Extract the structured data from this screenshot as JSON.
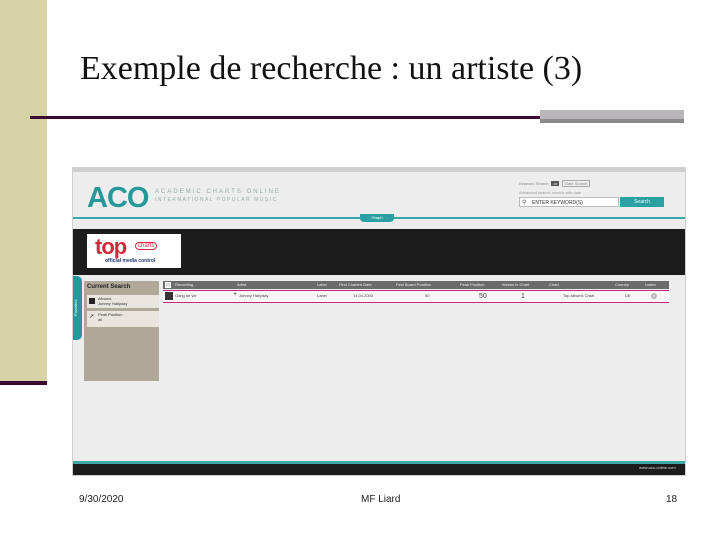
{
  "slide": {
    "title": "Exemple de recherche : un artiste (3)",
    "footer_date": "9/30/2020",
    "footer_author": "MF Liard",
    "page_number": "18"
  },
  "screenshot": {
    "logo": "ACO",
    "logo_sub1": "ACADEMIC CHARTS ONLINE",
    "logo_sub2": "INTERNATIONAL POPULAR MUSIC",
    "search_mode_label": "Keyword Search",
    "search_mode_chip1": "or",
    "search_mode_chip2": "Date Search",
    "advanced_search_link": "Advanced search, search with date",
    "search_input_value": "ENTER KEYWORD(S)",
    "search_button": "Search",
    "graph_tab": "Graph",
    "chart_logo_top": "top",
    "chart_logo_charts": "charts",
    "chart_logo_official": "official media control",
    "side_tab": "Favorites",
    "current_search_title": "Current Search",
    "current_search_item1": [
      "Albums",
      "Johnny Hallyday"
    ],
    "current_search_item2": [
      "Peak Position",
      "all"
    ],
    "table_headers": [
      "Recording",
      "Artist",
      "Label",
      "First Charted Date",
      "First Board Position",
      "Peak Position",
      "Weeks in Chart",
      "Chart",
      "Country",
      "Listen"
    ],
    "table_row": {
      "recording": "Gang de vie",
      "artist": "Johnny Hallyday",
      "label": "Label",
      "first_charted": "14.04.2003",
      "first_position": "50",
      "peak_position": "50",
      "weeks": "1",
      "chart": "Top albums Chart",
      "country": "DE"
    },
    "bottom_link": "www.aco-online.com"
  }
}
